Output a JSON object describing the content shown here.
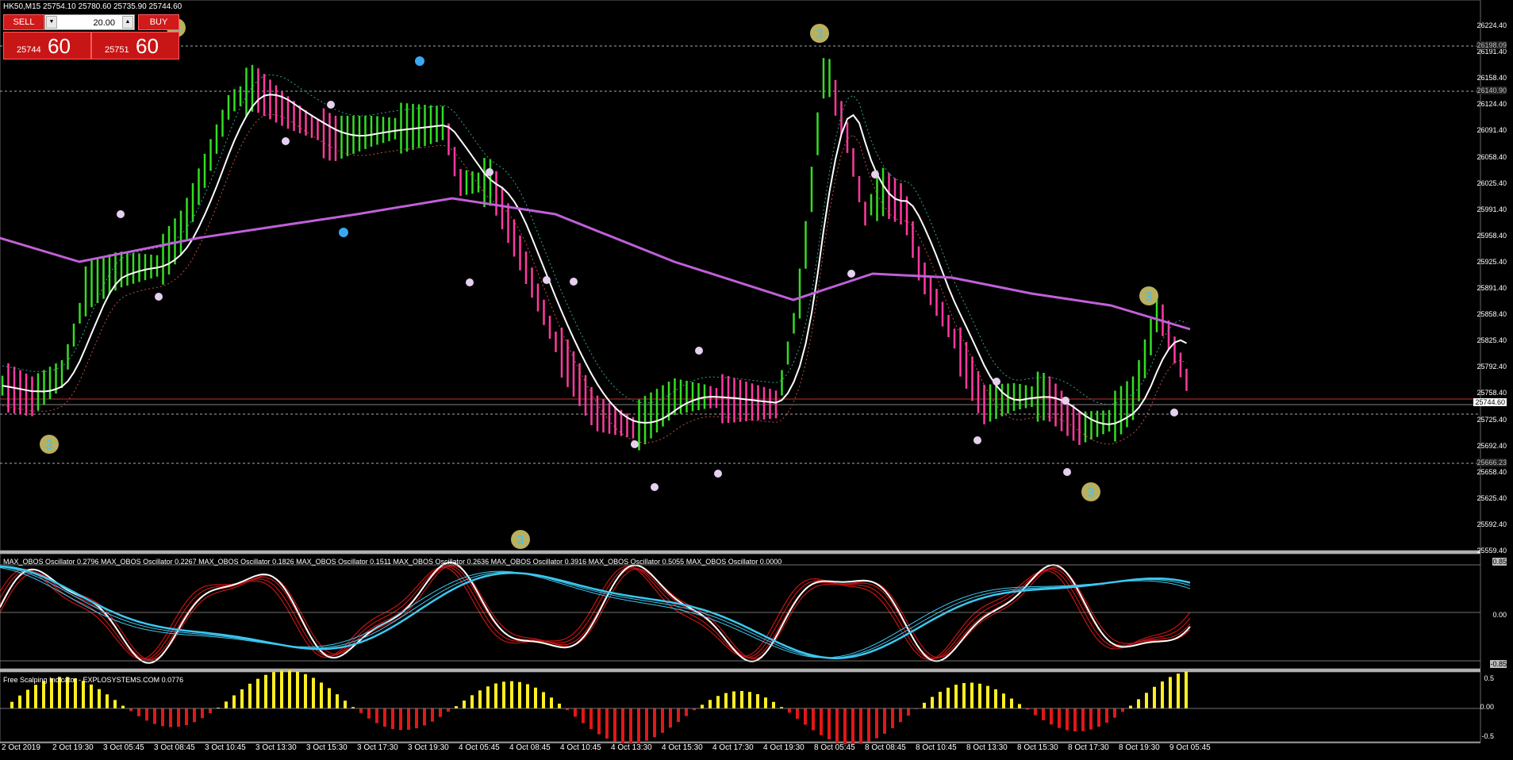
{
  "chart_header": "HK50,M15  25754.10 25780.60 25735.90 25744.60",
  "trade_panel": {
    "sell_label": "SELL",
    "buy_label": "BUY",
    "volume_value": "20.00",
    "sell_price_small": "25744",
    "sell_price_big": "60",
    "buy_price_small": "25751",
    "buy_price_big": "60"
  },
  "price_axis": [
    "26224.40",
    "26191.40",
    "26158.40",
    "26124.40",
    "26091.40",
    "26058.40",
    "26025.40",
    "25991.40",
    "25958.40",
    "25925.40",
    "25891.40",
    "25858.40",
    "25825.40",
    "25792.40",
    "25758.40",
    "25725.40",
    "25692.40",
    "25658.40",
    "25625.40",
    "25592.40",
    "25559.40"
  ],
  "price_tags": {
    "level1": "26198.09",
    "level2": "26140.90",
    "bid": "25744.60",
    "level3": "25666.23"
  },
  "oscillator_header": "MAX_OBOS Oscillator 0.2796  MAX_OBOS Oscillator 0.2267  MAX_OBOS Oscillator 0.1826  MAX_OBOS Oscillator 0.1511  MAX_OBOS Oscillator 0.2636  MAX_OBOS Oscillator 0.3916  MAX_OBOS Oscillator 0.5055  MAX_OBOS Oscillator 0.0000",
  "oscillator_axis": [
    "0.85",
    "0.00",
    "-0.85"
  ],
  "scalping_header": "Free Scalping Indicator - EXPLOSYSTEMS.COM 0.0776",
  "scalping_axis": [
    "0.5",
    "0.00",
    "-0.5"
  ],
  "time_axis": [
    "2 Oct 2019",
    "2 Oct 19:30",
    "3 Oct 05:45",
    "3 Oct 08:45",
    "3 Oct 10:45",
    "3 Oct 13:30",
    "3 Oct 15:30",
    "3 Oct 17:30",
    "3 Oct 19:30",
    "4 Oct 05:45",
    "4 Oct 08:45",
    "4 Oct 10:45",
    "4 Oct 13:30",
    "4 Oct 15:30",
    "4 Oct 17:30",
    "4 Oct 19:30",
    "8 Oct 05:45",
    "8 Oct 08:45",
    "8 Oct 10:45",
    "8 Oct 13:30",
    "8 Oct 15:30",
    "8 Oct 17:30",
    "8 Oct 19:30",
    "9 Oct 05:45"
  ],
  "colors": {
    "bull": "#33dd22",
    "bear": "#ff3aa0",
    "ma_slow": "#c060d8",
    "ma_fast": "#ffffff",
    "osc_red": "#c41414",
    "osc_blue": "#3cc8f0",
    "hist_up": "#ffee22",
    "hist_down": "#e01818"
  },
  "markers": {
    "small_label": "1",
    "big_label": "3",
    "blue_label": "2"
  }
}
